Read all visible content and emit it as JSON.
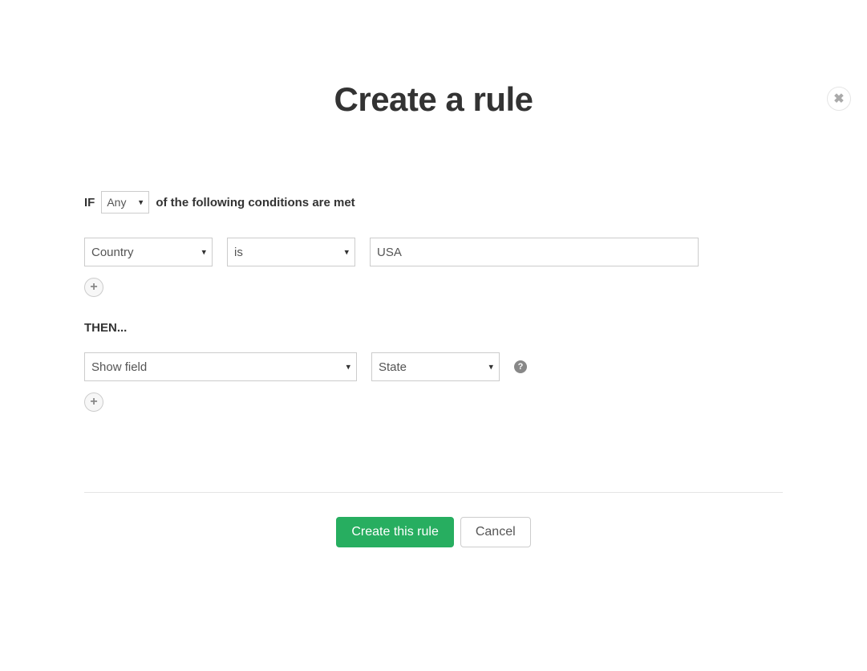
{
  "title": "Create a rule",
  "if": {
    "label": "IF",
    "match_mode": "Any",
    "suffix": "of the following conditions are met"
  },
  "condition": {
    "field": "Country",
    "operator": "is",
    "value": "USA"
  },
  "then": {
    "label": "THEN...",
    "action": "Show field",
    "target": "State"
  },
  "buttons": {
    "submit": "Create this rule",
    "cancel": "Cancel"
  },
  "icons": {
    "add": "+",
    "help": "?"
  }
}
